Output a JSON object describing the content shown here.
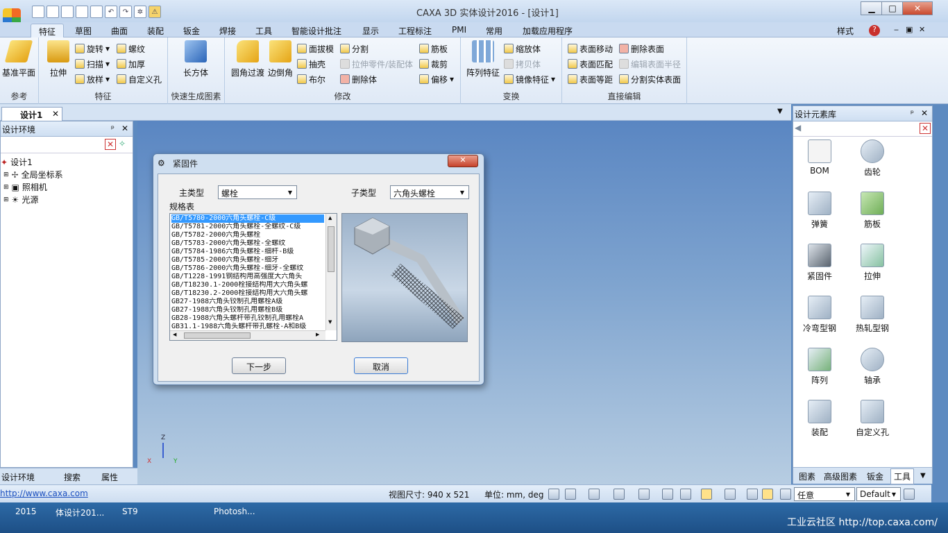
{
  "window": {
    "title": "CAXA 3D 实体设计2016 - [设计1]",
    "min_icon": "minimize-icon",
    "max_icon": "maximize-icon",
    "close_icon": "close-icon"
  },
  "ribbon": {
    "tabs": [
      "特征",
      "草图",
      "曲面",
      "装配",
      "钣金",
      "焊接",
      "工具",
      "智能设计批注",
      "显示",
      "工程标注",
      "PMI",
      "常用",
      "加载应用程序"
    ],
    "active_tab": "特征",
    "style_label": "样式",
    "help_icon": "help-icon",
    "groups": {
      "ref": {
        "label": "参考",
        "base_plane": "基准平面"
      },
      "feature": {
        "label": "特征",
        "extrude": "拉伸",
        "revolve": "旋转",
        "sweep": "扫描",
        "loft": "放样",
        "thread": "螺纹",
        "thicken": "加厚",
        "custom_hole": "自定义孔"
      },
      "quick": {
        "label": "快速生成图素",
        "cuboid": "长方体"
      },
      "modify": {
        "label": "修改",
        "fillet": "圆角过渡",
        "chamfer": "边倒角",
        "draft": "面拔模",
        "shell": "抽壳",
        "boolean": "布尔",
        "split": "分割",
        "stretch_part": "拉伸零件/装配体",
        "delete_body": "删除体",
        "rib": "筋板",
        "trim": "裁剪",
        "offset": "偏移"
      },
      "transform": {
        "label": "变换",
        "array": "阵列特征",
        "scale": "缩放体",
        "copy": "拷贝体",
        "mirror": "镜像特征"
      },
      "direct_edit": {
        "label": "直接编辑",
        "move_face": "表面移动",
        "match_face": "表面匹配",
        "equidistant_face": "表面等距",
        "delete_face": "删除表面",
        "edit_radius": "编辑表面半径",
        "split_face": "分割实体表面"
      }
    }
  },
  "doc_tab": {
    "label": "设计1"
  },
  "left_panel": {
    "title": "设计环境",
    "tree": [
      {
        "label": "设计1",
        "icon": "design-icon"
      },
      {
        "label": "全局坐标系",
        "icon": "axes-icon"
      },
      {
        "label": "照相机",
        "icon": "camera-icon"
      },
      {
        "label": "光源",
        "icon": "light-icon"
      }
    ],
    "bottom_tabs": [
      "设计环境",
      "搜索",
      "属性"
    ]
  },
  "dialog": {
    "title": "紧固件",
    "main_type_label": "主类型",
    "main_type_value": "螺栓",
    "sub_type_label": "子类型",
    "sub_type_value": "六角头螺栓",
    "spec_label": "规格表",
    "spec_list": [
      "GB/T5780-2000六角头螺栓-C级",
      "GB/T5781-2000六角头螺栓-全螺纹-C级",
      "GB/T5782-2000六角头螺栓",
      "GB/T5783-2000六角头螺栓-全螺纹",
      "GB/T5784-1986六角头螺栓-细杆-B级",
      "GB/T5785-2000六角头螺栓-细牙",
      "GB/T5786-2000六角头螺栓-细牙-全螺纹",
      "GB/T1228-1991钢结构用高强度大六角头",
      "GB/T18230.1-2000栓接结构用大六角头螺",
      "GB/T18230.2-2000栓接结构用大六角头螺",
      "GB27-1988六角头铰制孔用螺栓A级",
      "GB27-1988六角头铰制孔用螺栓B级",
      "GB28-1988六角头螺杆带孔铰制孔用螺栓A",
      "GB31.1-1988六角头螺杆带孔螺栓-A和B级"
    ],
    "selected_index": 0,
    "next_button": "下一步",
    "cancel_button": "取消"
  },
  "axis_triad": {
    "z": "Z",
    "x": "X",
    "y": "Y"
  },
  "right_panel": {
    "title": "设计元素库",
    "items": [
      "BOM",
      "齿轮",
      "弹簧",
      "筋板",
      "紧固件",
      "拉伸",
      "冷弯型钢",
      "热轧型钢",
      "阵列",
      "轴承",
      "装配",
      "自定义孔"
    ],
    "bottom_tabs": [
      "图素",
      "高级图素",
      "钣金",
      "工具"
    ],
    "active_bottom_tab": "工具"
  },
  "status": {
    "url": "http://www.caxa.com",
    "view_size": "视图尺寸: 940 x 521",
    "units": "单位: mm, deg",
    "select_mode": "任意",
    "style": "Default"
  },
  "taskbar": {
    "items": [
      "2015",
      "体设计201...",
      "ST9",
      "Photosh..."
    ],
    "watermark": "工业云社区 http://top.caxa.com/"
  }
}
